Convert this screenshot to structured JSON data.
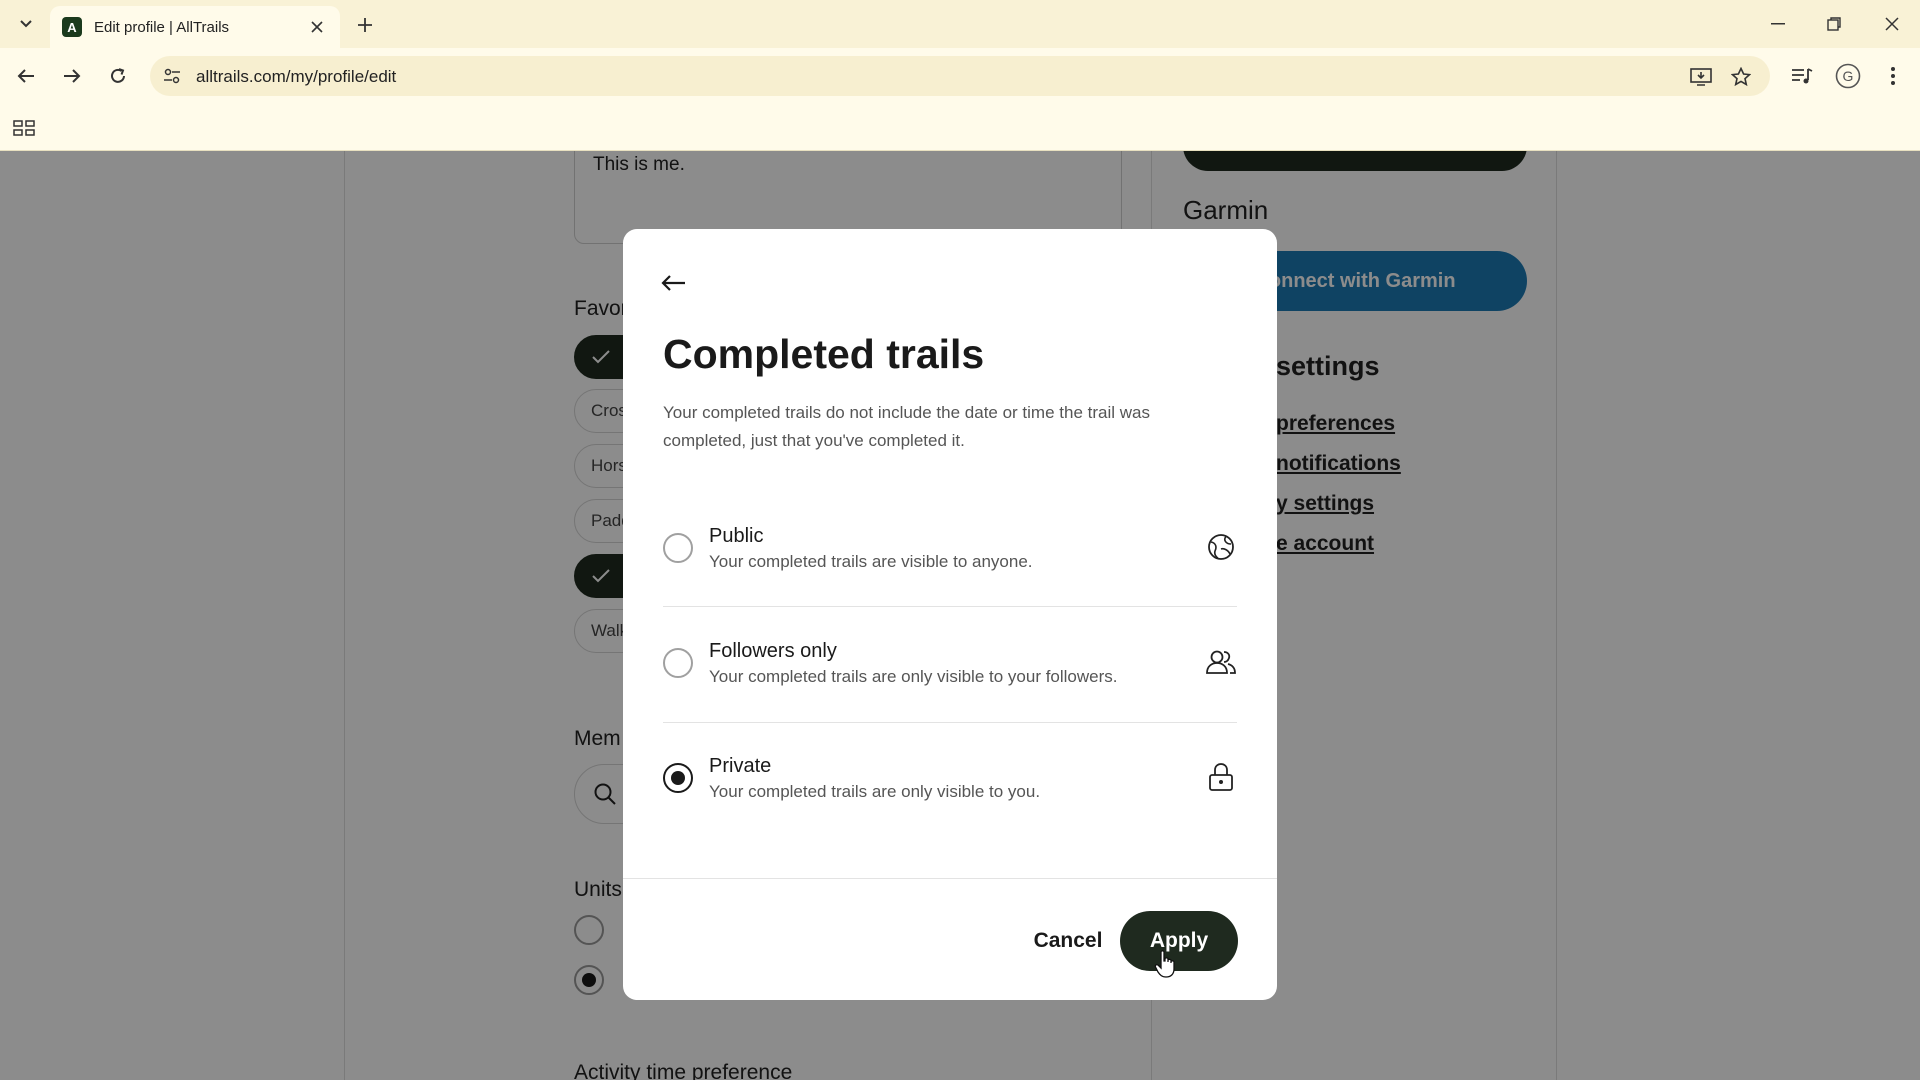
{
  "browser": {
    "tab_title": "Edit profile | AllTrails",
    "tab_favicon_letter": "A",
    "url": "alltrails.com/my/profile/edit",
    "profile_initial": "G"
  },
  "page": {
    "bio_text": "This is me.",
    "favorites_label": "Favor",
    "chips": [
      "Cros",
      "Hors",
      "Padd",
      "Walk"
    ],
    "members_label": "Mem",
    "units_label": "Units",
    "activity_label": "Activity time preference",
    "garmin_title": "Garmin",
    "garmin_button": "Connect with Garmin",
    "account_title": "settings",
    "account_links": [
      "preferences",
      "notifications",
      "y settings",
      "e account"
    ]
  },
  "modal": {
    "title": "Completed trails",
    "description": "Your completed trails do not include the date or time the trail was completed, just that you've completed it.",
    "options": [
      {
        "label": "Public",
        "sub": "Your completed trails are visible to anyone.",
        "icon": "globe-icon",
        "selected": false
      },
      {
        "label": "Followers only",
        "sub": "Your completed trails are only visible to your followers.",
        "icon": "followers-icon",
        "selected": false
      },
      {
        "label": "Private",
        "sub": "Your completed trails are only visible to you.",
        "icon": "lock-icon",
        "selected": true
      }
    ],
    "cancel_label": "Cancel",
    "apply_label": "Apply"
  },
  "colors": {
    "tab_bar": "#f9f2d6",
    "toolbar": "#fffbea",
    "primary_dark": "#1f2a1f",
    "garmin_blue": "#1d7bb5"
  }
}
